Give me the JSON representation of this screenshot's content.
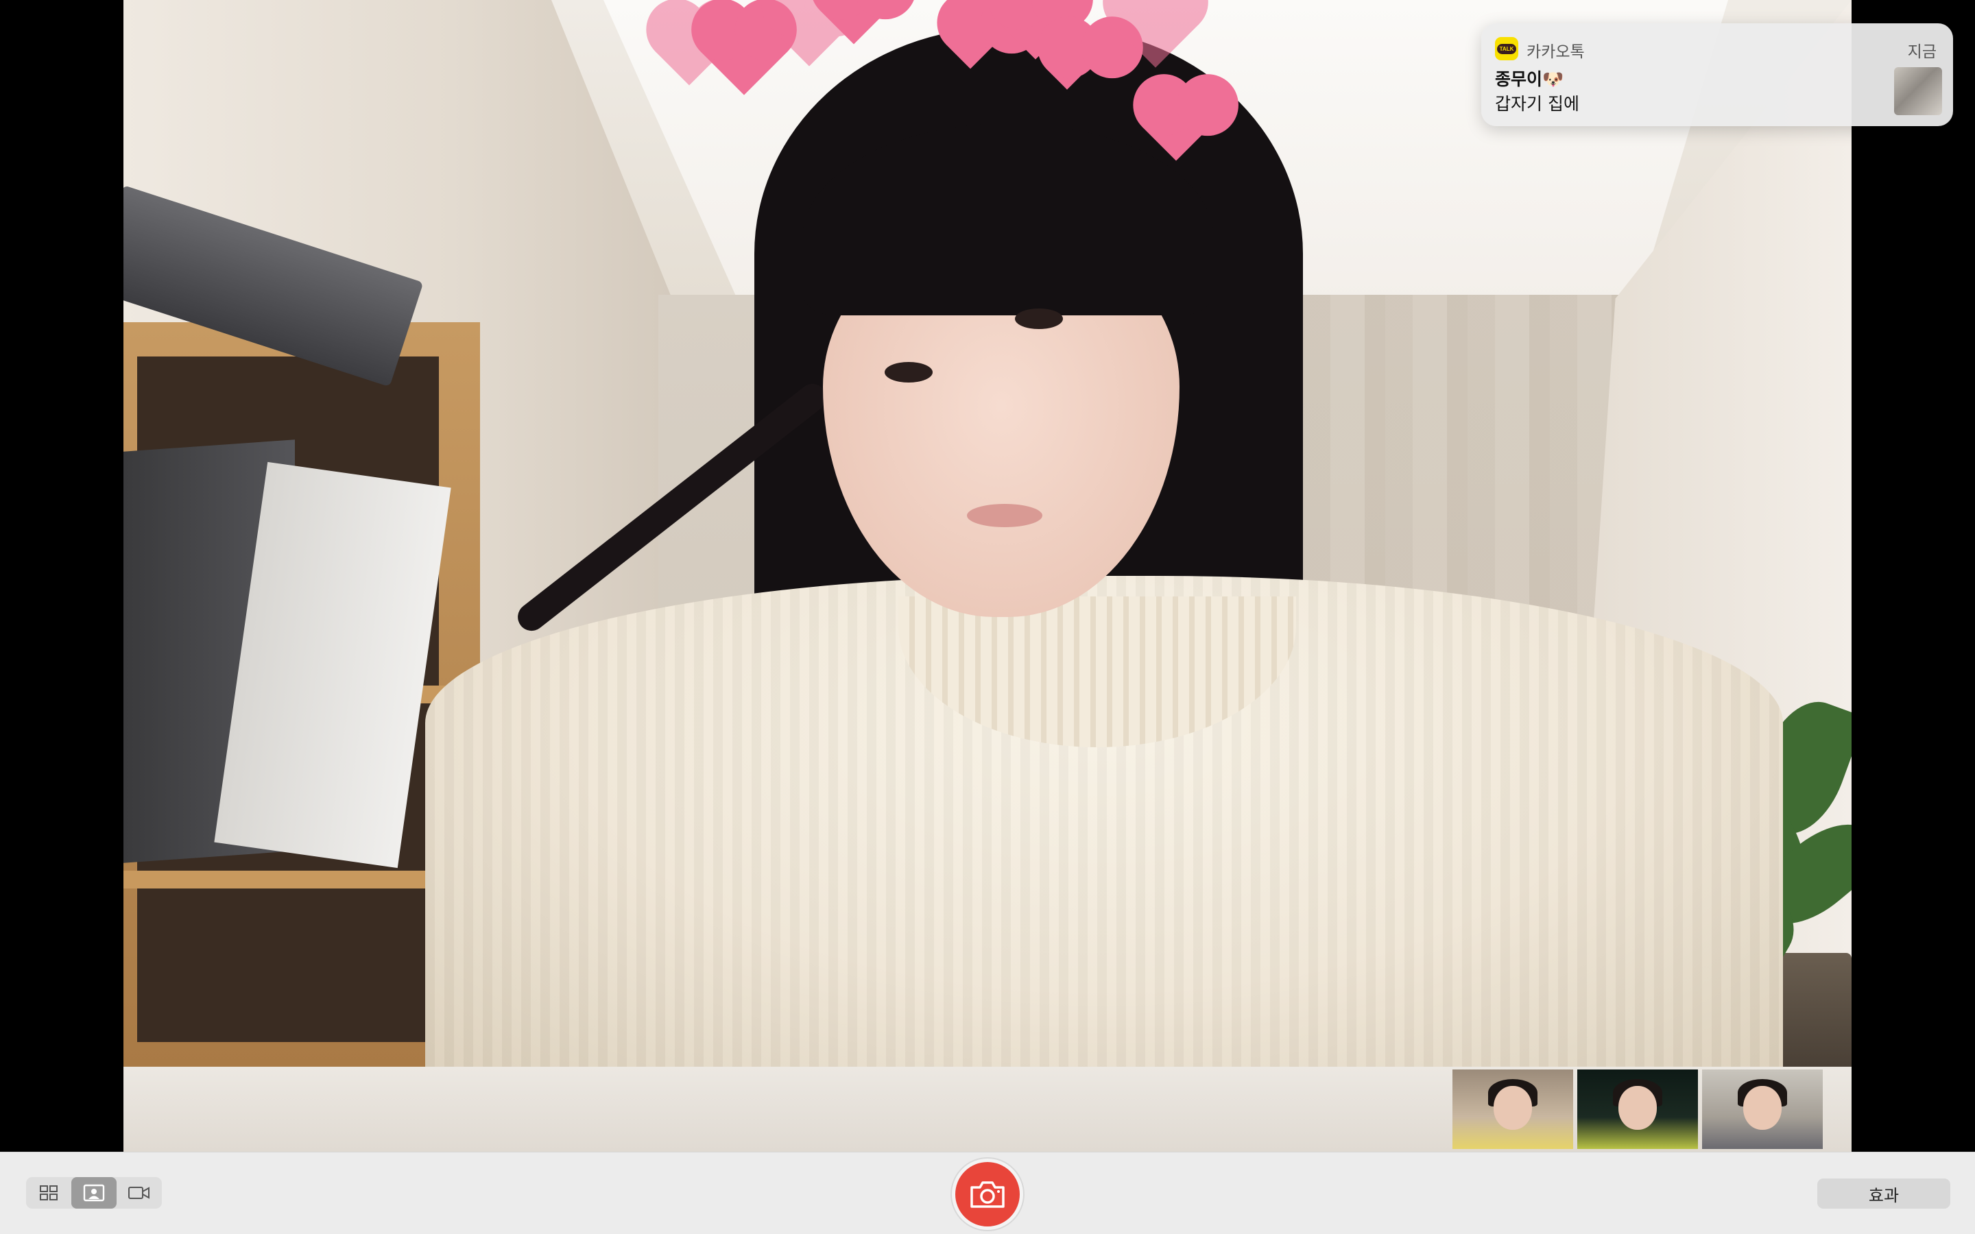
{
  "notification": {
    "app_name": "카카오톡",
    "time": "지금",
    "title": "종무이🐶",
    "body": "갑자기 집에",
    "app_icon_label": "TALK",
    "app_icon": "kakaotalk-icon"
  },
  "toolbar": {
    "view_buttons": [
      {
        "icon": "grid-view-icon",
        "active": false
      },
      {
        "icon": "single-photo-view-icon",
        "active": true
      },
      {
        "icon": "video-camera-icon",
        "active": false
      }
    ],
    "shutter_icon": "camera-icon",
    "effects_label": "효과"
  },
  "filmstrip": {
    "count": 3
  },
  "colors": {
    "shutter": "#e8453a",
    "heart": "#ef6f96",
    "kakao_yellow": "#f9e000"
  }
}
